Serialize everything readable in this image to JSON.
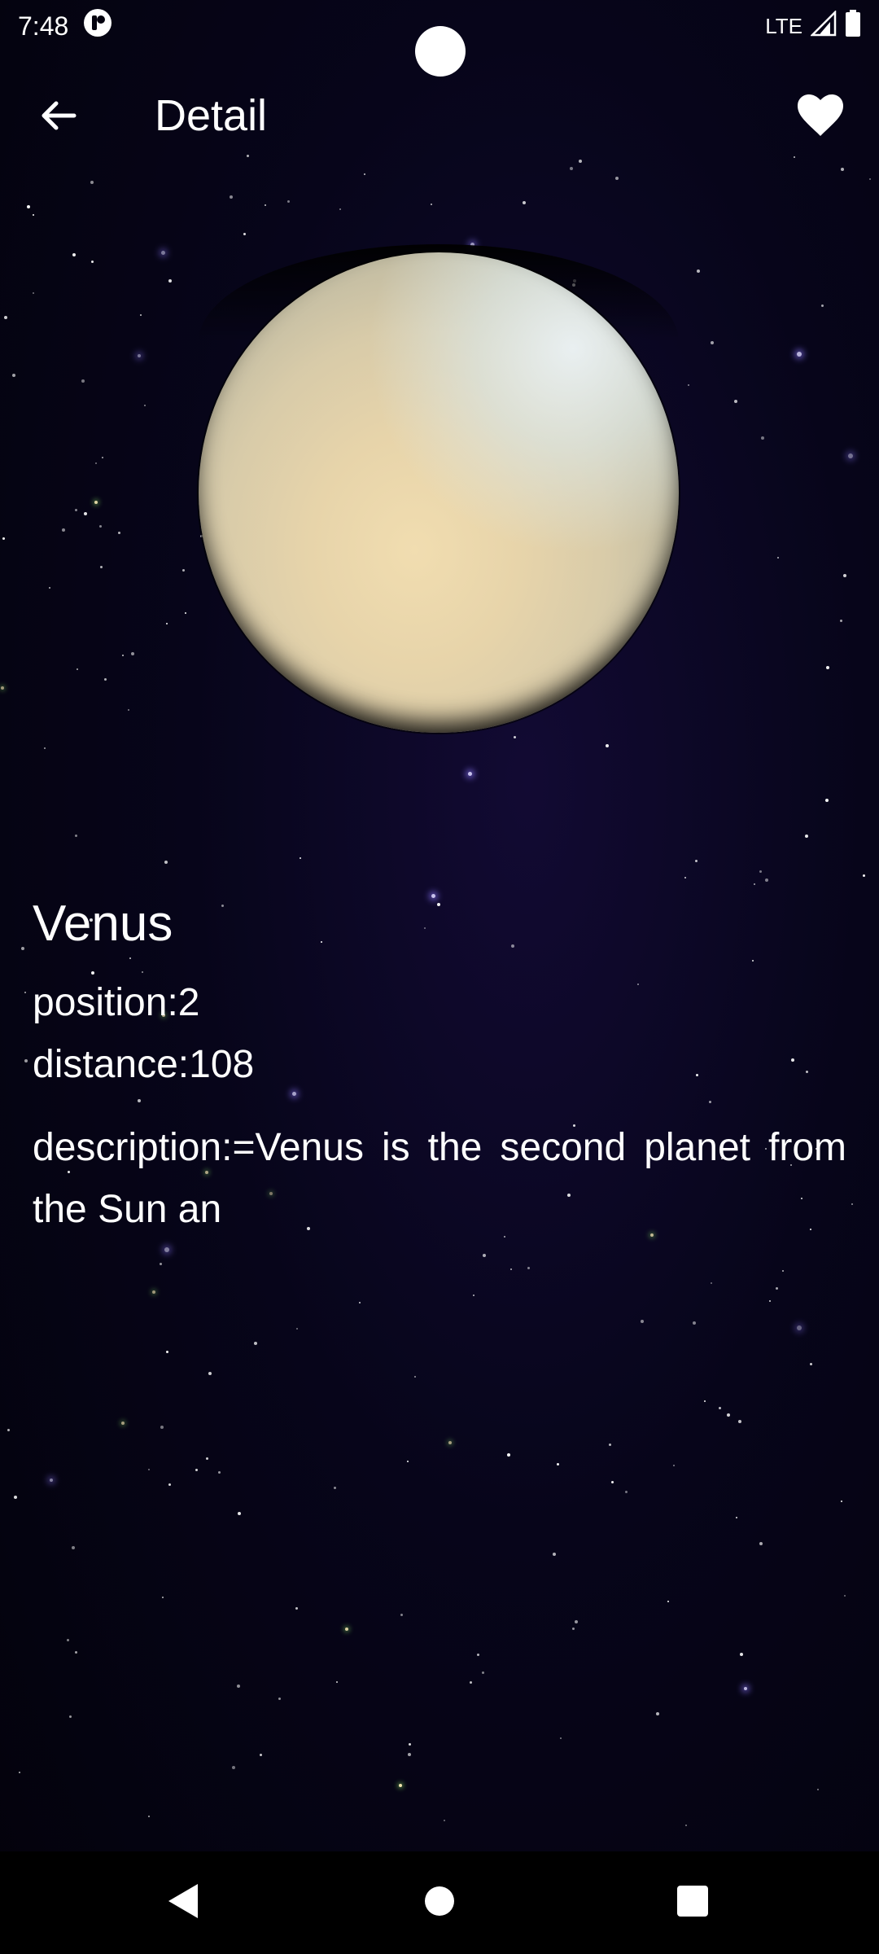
{
  "status_bar": {
    "time": "7:48",
    "network": "LTE"
  },
  "app_bar": {
    "title": "Detail",
    "back_icon": "arrow-left-icon",
    "favorite_icon": "heart-icon"
  },
  "planet": {
    "name": "Venus",
    "position_text": "position:2",
    "distance_text": "distance:108",
    "description_text": "description:=Venus is the second planet from the Sun an"
  },
  "nav_bar": {
    "back_icon": "triangle-back-icon",
    "home_icon": "circle-home-icon",
    "recents_icon": "square-recents-icon"
  },
  "colors": {
    "background": "#05030f",
    "text": "#ffffff",
    "nav_bar": "#000000"
  }
}
